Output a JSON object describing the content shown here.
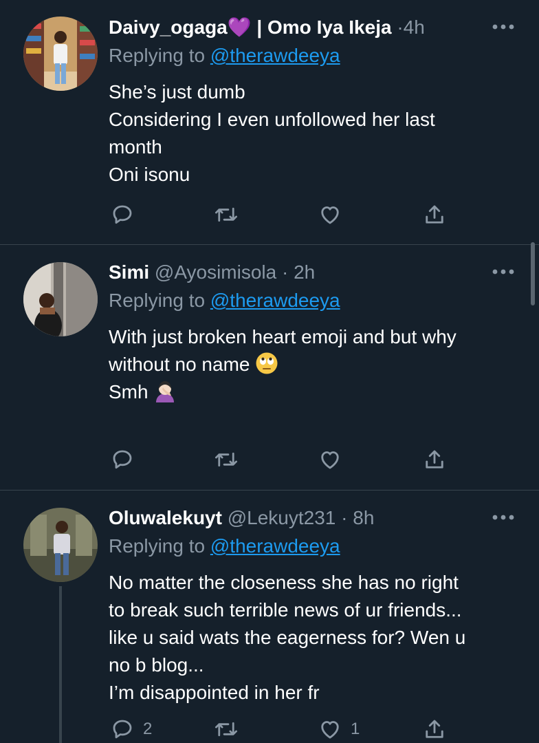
{
  "colors": {
    "background": "#15202b",
    "text_primary": "#ffffff",
    "text_secondary": "#8b98a5",
    "link": "#1d9bf0",
    "divider": "#38444d"
  },
  "tweets": [
    {
      "display_name": "Daivy_ogaga",
      "name_suffix": "💜 | Omo Iya Ikeja",
      "handle": "",
      "separator": "·",
      "time": "4h",
      "replying_prefix": "Replying to ",
      "replying_to": "@therawdeeya",
      "text_lines": [
        "She’s just dumb",
        "Considering I even unfollowed her last",
        "month",
        "Oni isonu"
      ],
      "reply_count": "",
      "retweet_count": "",
      "like_count": "",
      "avatar_icon": "avatar-photo",
      "more_icon": "more-horizontal-icon"
    },
    {
      "display_name": "Simi",
      "name_suffix": "",
      "handle": "@Ayosimisola",
      "separator": "·",
      "time": "2h",
      "replying_prefix": "Replying to ",
      "replying_to": "@therawdeeya",
      "text_lines": [
        "With just broken heart emoji and but why",
        "without no name",
        "",
        "Smh"
      ],
      "line_emojis": [
        "",
        "face-with-rolling-eyes-emoji",
        "",
        "woman-facepalming-emoji"
      ],
      "reply_count": "",
      "retweet_count": "",
      "like_count": ""
    },
    {
      "display_name": "Oluwalekuyt",
      "name_suffix": "",
      "handle": "@Lekuyt231",
      "separator": "·",
      "time": "8h",
      "replying_prefix": "Replying to ",
      "replying_to": "@therawdeeya",
      "text_lines": [
        "No matter the closeness she has no right",
        "to break such terrible news of ur friends...",
        "like u said wats the eagerness for? Wen u",
        "no b blog...",
        "I’m disappointed in her fr"
      ],
      "reply_count": "2",
      "retweet_count": "",
      "like_count": "1"
    }
  ],
  "action_icons": [
    "reply-icon",
    "retweet-icon",
    "like-icon",
    "share-icon"
  ]
}
